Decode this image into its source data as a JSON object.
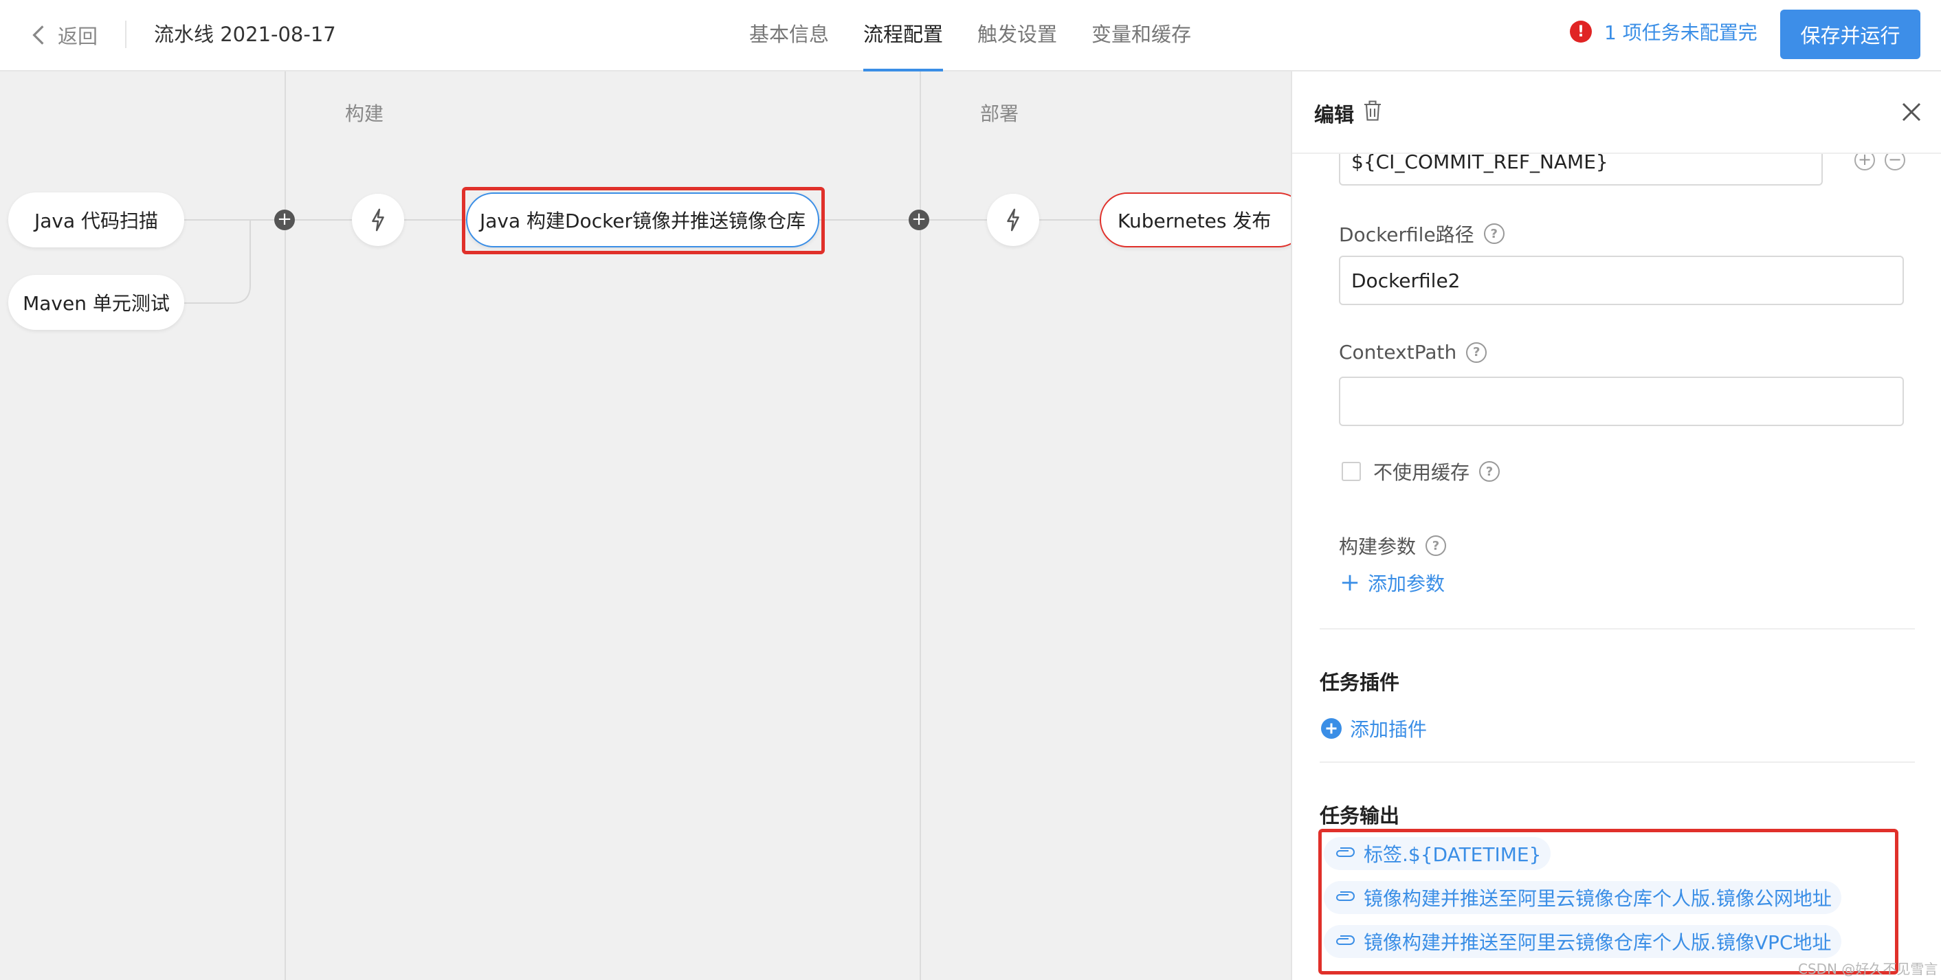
{
  "header": {
    "back_label": "返回",
    "pipeline_title": "流水线 2021-08-17",
    "tabs": [
      {
        "label": "基本信息"
      },
      {
        "label": "流程配置"
      },
      {
        "label": "触发设置"
      },
      {
        "label": "变量和缓存"
      }
    ],
    "active_tab": "流程配置",
    "warning_text": "1 项任务未配置完",
    "save_run_label": "保存并运行"
  },
  "canvas": {
    "stages": [
      {
        "label": "构建"
      },
      {
        "label": "部署"
      }
    ],
    "source_jobs": [
      {
        "label": "Java 代码扫描"
      },
      {
        "label": "Maven 单元测试"
      }
    ],
    "build_job": {
      "label": "Java 构建Docker镜像并推送镜像仓库"
    },
    "deploy_job": {
      "label": "Kubernetes 发布"
    }
  },
  "panel": {
    "title": "编辑",
    "tag_value": "${CI_COMMIT_REF_NAME}",
    "dockerfile": {
      "label": "Dockerfile路径",
      "value": "Dockerfile2"
    },
    "context_path": {
      "label": "ContextPath",
      "value": ""
    },
    "no_cache": {
      "label": "不使用缓存",
      "checked": false
    },
    "build_args": {
      "label": "构建参数",
      "add_label": "添加参数"
    },
    "plugins": {
      "title": "任务插件",
      "add_label": "添加插件"
    },
    "outputs": {
      "title": "任务输出",
      "items": [
        {
          "label": "标签.${DATETIME}"
        },
        {
          "label": "镜像构建并推送至阿里云镜像仓库个人版.镜像公网地址"
        },
        {
          "label": "镜像构建并推送至阿里云镜像仓库个人版.镜像VPC地址"
        }
      ]
    }
  },
  "watermark": "CSDN @好久不见雪言",
  "colors": {
    "accent": "#3a8ee6",
    "error": "#e0302a",
    "warning_icon": "#e02424"
  }
}
